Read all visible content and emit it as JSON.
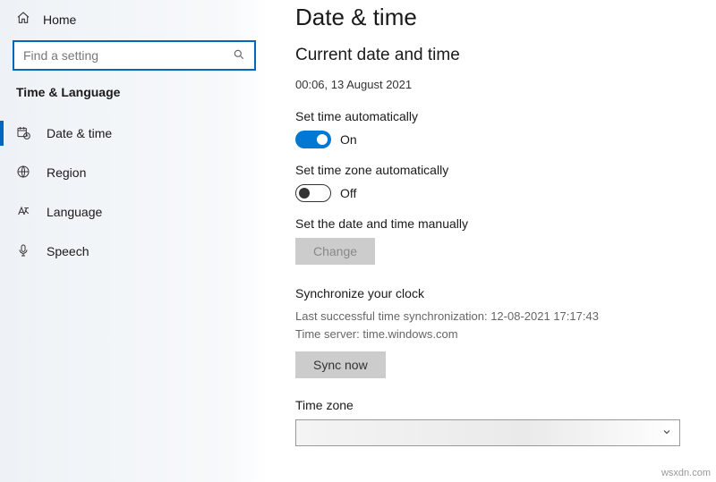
{
  "sidebar": {
    "home": "Home",
    "searchPlaceholder": "Find a setting",
    "category": "Time & Language",
    "items": [
      {
        "label": "Date & time"
      },
      {
        "label": "Region"
      },
      {
        "label": "Language"
      },
      {
        "label": "Speech"
      }
    ]
  },
  "main": {
    "title": "Date & time",
    "subtitle": "Current date and time",
    "current": "00:06, 13 August 2021",
    "setTimeAuto": {
      "label": "Set time automatically",
      "state": "On"
    },
    "setZoneAuto": {
      "label": "Set time zone automatically",
      "state": "Off"
    },
    "manual": {
      "label": "Set the date and time manually",
      "button": "Change"
    },
    "sync": {
      "title": "Synchronize your clock",
      "lastLine": "Last successful time synchronization: 12-08-2021 17:17:43",
      "serverLine": "Time server: time.windows.com",
      "button": "Sync now"
    },
    "timezone": {
      "label": "Time zone"
    }
  },
  "watermark": "wsxdn.com"
}
